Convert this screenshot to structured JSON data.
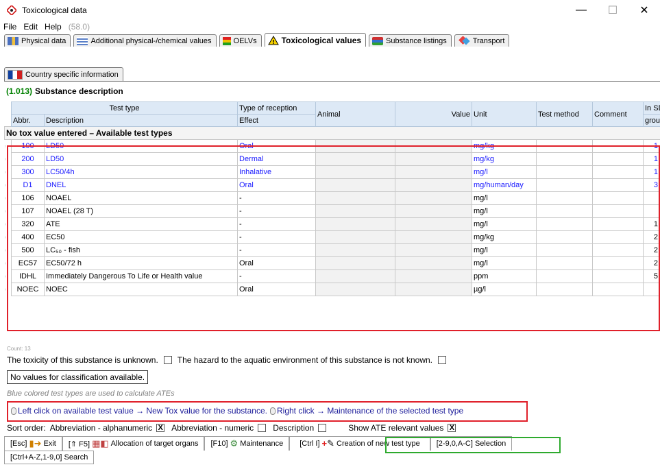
{
  "window": {
    "title": "Toxicological data",
    "minimize": "—",
    "maximize": "☐",
    "close": "✕"
  },
  "menu": {
    "file": "File",
    "edit": "Edit",
    "help": "Help",
    "version": "(58.0)"
  },
  "tabs": [
    {
      "label": "Physical data",
      "icon": "physical-icon"
    },
    {
      "label": "Additional physical-/chemical values",
      "icon": "chemical-icon"
    },
    {
      "label": "OELVs",
      "icon": "oelv-icon"
    },
    {
      "label": "Toxicological values",
      "icon": "warning-icon",
      "active": true
    },
    {
      "label": "Substance listings",
      "icon": "books-icon"
    },
    {
      "label": "Transport",
      "icon": "transport-icon"
    }
  ],
  "tabs2": [
    {
      "label": "Country specific information",
      "icon": "flag-icon"
    }
  ],
  "section": {
    "number": "(1.013)",
    "title": "Substance description"
  },
  "table": {
    "headers": {
      "test_type": "Test type",
      "type_of_reception": "Type of reception",
      "animal": "Animal",
      "value": "Value",
      "unit": "Unit",
      "test_method": "Test method",
      "comment": "Comment",
      "in_sds": "In SD",
      "abbr": "Abbr.",
      "description": "Description",
      "effect": "Effect",
      "group": "group"
    },
    "subhead": "No tox value entered – Available test types",
    "rows": [
      {
        "abbr": "100",
        "desc": "LD50",
        "reception": "Oral",
        "unit": "mg/kg",
        "group": "1",
        "blue": true
      },
      {
        "abbr": "200",
        "desc": "LD50",
        "reception": "Dermal",
        "unit": "mg/kg",
        "group": "1",
        "blue": true
      },
      {
        "abbr": "300",
        "desc": "LC50/4h",
        "reception": "Inhalative",
        "unit": "mg/l",
        "group": "1",
        "blue": true
      },
      {
        "abbr": "D1",
        "desc": "DNEL",
        "reception": "Oral",
        "unit": "mg/human/day",
        "group": "3",
        "blue": true
      },
      {
        "abbr": "106",
        "desc": "NOAEL",
        "reception": "-",
        "unit": "mg/l",
        "group": "",
        "blue": false
      },
      {
        "abbr": "107",
        "desc": "NOAEL (28 T)",
        "reception": "-",
        "unit": "mg/l",
        "group": "",
        "blue": false
      },
      {
        "abbr": "320",
        "desc": "ATE",
        "reception": "-",
        "unit": "mg/l",
        "group": "1",
        "blue": false
      },
      {
        "abbr": "400",
        "desc": "EC50",
        "reception": "-",
        "unit": "mg/kg",
        "group": "2",
        "blue": false
      },
      {
        "abbr": "500",
        "desc": "LC₅₀ - fish",
        "reception": "-",
        "unit": "mg/l",
        "group": "2",
        "blue": false
      },
      {
        "abbr": "EC57",
        "desc": "EC50/72 h",
        "reception": "Oral",
        "unit": "mg/l",
        "group": "2",
        "blue": false
      },
      {
        "abbr": "IDHL",
        "desc": "Immediately Dangerous To Life or Health value",
        "reception": "-",
        "unit": "ppm",
        "group": "5",
        "blue": false
      },
      {
        "abbr": "NOEC",
        "desc": "NOEC",
        "reception": "Oral",
        "unit": "µg/l",
        "group": "",
        "blue": false
      }
    ]
  },
  "footer": {
    "count": "Count: 13",
    "tox_unknown": "The toxicity of this substance is unknown.",
    "aquatic_unknown": "The hazard to the aquatic environment of this substance is not known.",
    "no_values": "No values for classification available.",
    "blue_note": "Blue colored test types are used to calculate ATEs",
    "hint_left": "Left click on available test value → New Tox value for the substance.",
    "hint_right": "Right click → Maintenance of the selected test type",
    "sort_order": "Sort order:",
    "sort_alpha": "Abbreviation - alphanumeric",
    "sort_numeric": "Abbreviation - numeric",
    "sort_desc": "Description",
    "show_ate": "Show ATE relevant values",
    "checked": "X"
  },
  "fkeys": {
    "esc_key": "[Esc]",
    "exit": "Exit",
    "f5_key": "[⇑ F5]",
    "organs": "Allocation of target organs",
    "f10_key": "[F10]",
    "maintenance": "Maintenance",
    "ctrl_i_key": "[Ctrl I]",
    "new_test": "Creation of new test type",
    "selection": "[2-9,0,A-C] Selection",
    "search": "[Ctrl+A-Z,1-9,0] Search"
  }
}
